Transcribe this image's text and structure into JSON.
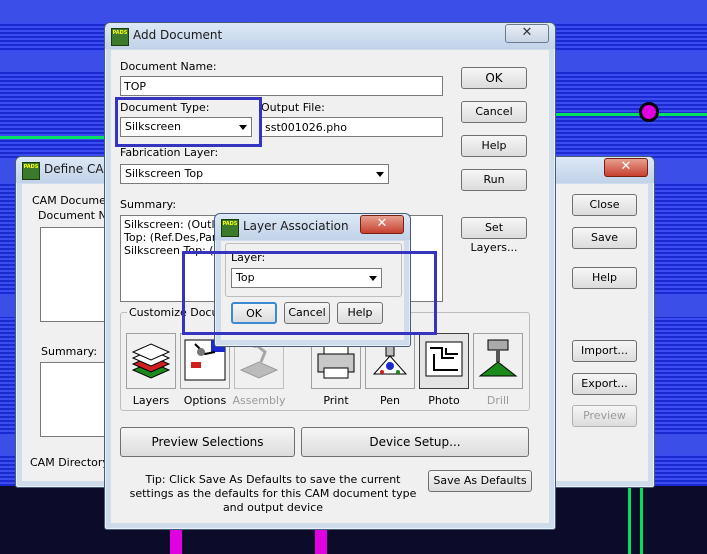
{
  "add_document": {
    "title": "Add Document",
    "close": "✕",
    "document_name_label": "Document Name:",
    "document_name_value": "TOP",
    "document_type_label": "Document Type:",
    "document_type_value": "Silkscreen",
    "output_file_label": "Output File:",
    "output_file_value": "sst001026.pho",
    "fab_layer_label": "Fabrication Layer:",
    "fab_layer_value": "Silkscreen Top",
    "summary_label": "Summary:",
    "summary_lines": [
      "Silkscreen: (Outline",
      "Top: (Ref.Des,Part",
      "Silkscreen Top: (Li"
    ],
    "buttons": {
      "ok": "OK",
      "cancel": "Cancel",
      "help": "Help",
      "run": "Run",
      "set_layers": "Set Layers..."
    },
    "customize_label": "Customize Document",
    "tools_left": [
      {
        "label": "Layers",
        "icon": "layers-icon"
      },
      {
        "label": "Options",
        "icon": "options-icon"
      },
      {
        "label": "Assembly",
        "icon": "assembly-icon"
      }
    ],
    "tools_right": [
      {
        "label": "Print",
        "icon": "printer-icon"
      },
      {
        "label": "Pen",
        "icon": "pen-plotter-icon"
      },
      {
        "label": "Photo",
        "icon": "photo-icon"
      },
      {
        "label": "Drill",
        "icon": "drill-icon"
      }
    ],
    "preview_selections": "Preview Selections",
    "device_setup": "Device Setup...",
    "tip": "Tip: Click Save As Defaults to save the current settings as the defaults for this CAM document type and output device",
    "save_as_defaults": "Save As Defaults"
  },
  "define_cam": {
    "title": "Define CAM",
    "close": "✕",
    "cam_documents_label": "CAM Docume",
    "document_name_label": "Document Na",
    "summary_label": "Summary:",
    "cam_directory_label": "CAM Directory:",
    "buttons": {
      "close": "Close",
      "save": "Save",
      "help": "Help",
      "import": "Import...",
      "export": "Export...",
      "preview": "Preview"
    }
  },
  "layer_assoc": {
    "title": "Layer Association",
    "close": "✕",
    "layer_label": "Layer:",
    "layer_value": "Top",
    "ok": "OK",
    "cancel": "Cancel",
    "help": "Help"
  },
  "app_icon_text": "PADS",
  "colors": {
    "highlight": "#3434c0",
    "background_blue": "#2a3ad8",
    "trace_green": "#00e060",
    "pad_magenta": "#e000e0"
  }
}
